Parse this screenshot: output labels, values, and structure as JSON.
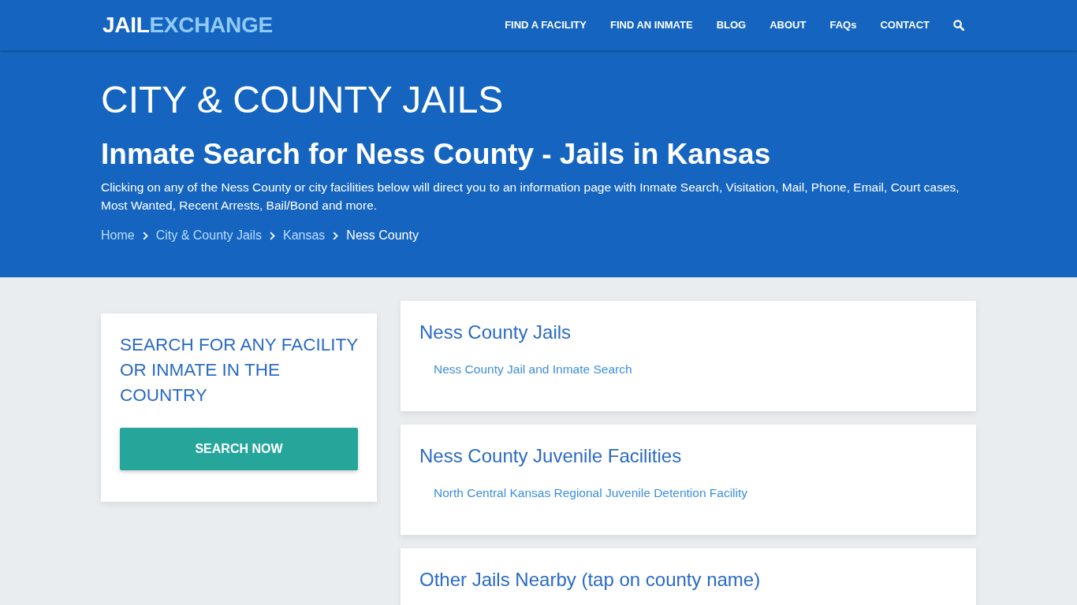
{
  "header": {
    "logo": {
      "lead": "JAIL",
      "accent": "EXCHANGE"
    },
    "nav": [
      "FIND A FACILITY",
      "FIND AN INMATE",
      "BLOG",
      "ABOUT",
      "FAQs",
      "CONTACT"
    ]
  },
  "hero": {
    "title": "CITY & COUNTY JAILS",
    "subtitle": "Inmate Search for Ness County - Jails in Kansas",
    "description": "Clicking on any of the Ness County or city facilities below will direct you to an information page with Inmate Search, Visitation, Mail, Phone, Email, Court cases, Most Wanted, Recent Arrests, Bail/Bond and more.",
    "breadcrumb": [
      {
        "label": "Home",
        "current": false
      },
      {
        "label": "City & County Jails",
        "current": false
      },
      {
        "label": "Kansas",
        "current": false
      },
      {
        "label": "Ness County",
        "current": true
      }
    ]
  },
  "sidebar": {
    "heading": "SEARCH FOR ANY FACILITY OR INMATE IN THE COUNTRY",
    "button": "SEARCH NOW"
  },
  "sections": [
    {
      "heading": "Ness County Jails",
      "links": [
        "Ness County Jail and Inmate Search"
      ]
    },
    {
      "heading": "Ness County Juvenile Facilities",
      "links": [
        "North Central Kansas Regional Juvenile Detention Facility"
      ]
    },
    {
      "heading": "Other Jails Nearby (tap on county name)"
    }
  ]
}
